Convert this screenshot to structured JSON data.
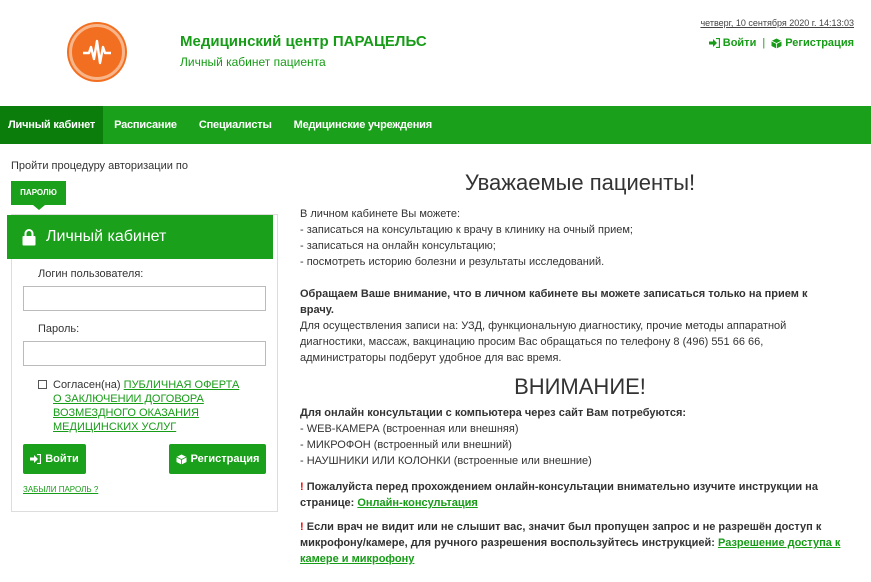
{
  "header": {
    "title": "Медицинский центр ПАРАЦЕЛЬС",
    "subtitle": "Личный кабинет пациента",
    "datetime": "четверг, 10 сентября 2020 г. 14:13:03",
    "login_label": "Войти",
    "separator": "|",
    "register_label": "Регистрация"
  },
  "nav": {
    "items": [
      {
        "label": "Личный кабинет"
      },
      {
        "label": "Расписание"
      },
      {
        "label": "Специалисты"
      },
      {
        "label": "Медицинские учреждения"
      }
    ]
  },
  "login": {
    "prompt": "Пройти процедуру авторизации по",
    "method_button": "ПАРОЛЮ",
    "panel_title": "Личный кабинет",
    "username_label": "Логин пользователя:",
    "username_value": "",
    "password_label": "Пароль:",
    "password_value": "",
    "agree_prefix": "Согласен(на)",
    "offer_link_1": "ПУБЛИЧНАЯ ОФЕРТА",
    "offer_link_2": "О ЗАКЛЮЧЕНИИ ДОГОВОРА",
    "offer_link_3": "ВОЗМЕЗДНОГО ОКАЗАНИЯ",
    "offer_link_4": "МЕДИЦИНСКИХ УСЛУГ",
    "login_button": "Войти",
    "register_button": "Регистрация",
    "forgot_link": "ЗАБЫЛИ ПАРОЛЬ ?"
  },
  "main": {
    "heading": "Уважаемые пациенты!",
    "intro": "В личном кабинете Вы можете:",
    "bullets": [
      "- записаться на консультацию к врачу в клинику на очный прием;",
      "- записаться на онлайн консультацию;",
      "- посмотреть историю болезни и результаты исследований."
    ],
    "notice_bold": "Обращаем Ваше внимание,  что в личном кабинете вы можете записаться только на прием к врачу.",
    "notice_text": "Для осуществления записи на: УЗД, функциональную диагностику, прочие методы аппаратной диагностики, массаж, вакцинацию просим Вас обращаться по телефону 8 (496) 551 66 66, администраторы подберут удобное для вас время.",
    "attention_heading": "ВНИМАНИЕ!",
    "req_bold": "Для онлайн консультации с компьютера через сайт Вам потребуются:",
    "reqs": [
      "- WEB-КАМЕРА (встроенная или внешняя)",
      "- МИКРОФОН (встроенный или внешний)",
      "- НАУШНИКИ ИЛИ КОЛОНКИ (встроенные или внешние)"
    ],
    "excl": "!",
    "warn1_text": "Пожалуйста перед прохождением онлайн-консультации внимательно изучите инструкции на странице:",
    "warn1_link": "Онлайн-консультация",
    "warn2_text": "Если врач не видит или не слышит вас, значит был пропущен запрос и не разрешён доступ к микрофону/камере, для ручного разрешения воспользуйтесь инструкцией:",
    "warn2_link": "Разрешение доступа к камере и микрофону"
  },
  "colors": {
    "brand_green": "#1aa01a",
    "nav_active": "#0b7d0b",
    "logo_orange": "#f26f21",
    "warning_red": "#ee0000"
  }
}
